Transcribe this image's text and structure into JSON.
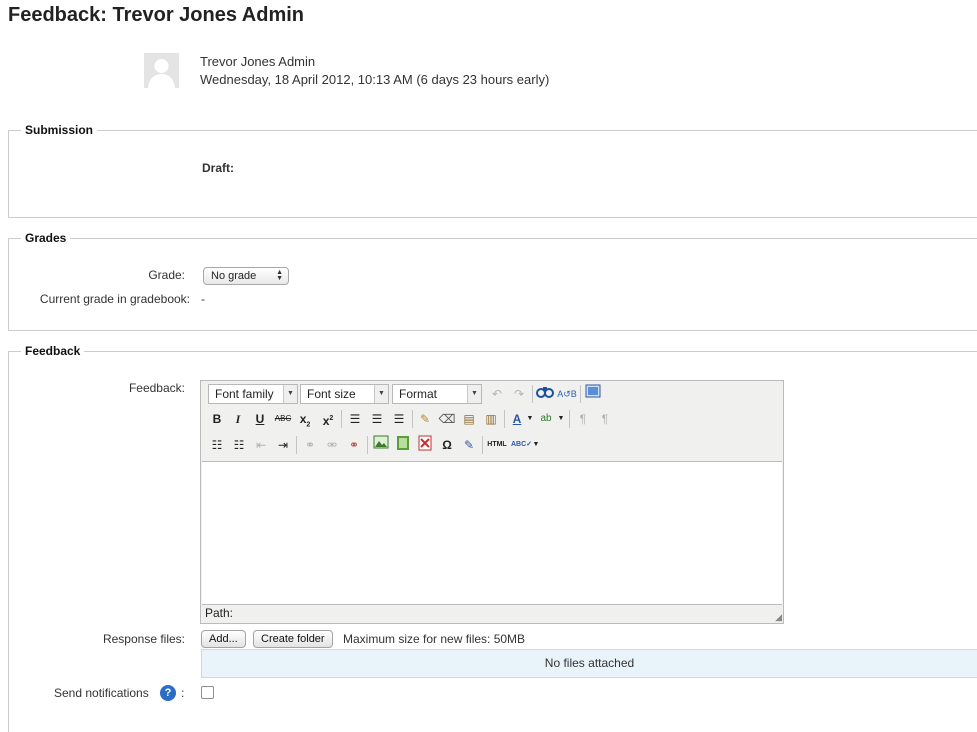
{
  "page": {
    "title": "Feedback: Trevor Jones Admin"
  },
  "user": {
    "name": "Trevor Jones Admin",
    "date": "Wednesday, 18 April 2012, 10:13 AM (6 days 23 hours early)"
  },
  "submission": {
    "legend": "Submission",
    "draft_label": "Draft:"
  },
  "grades": {
    "legend": "Grades",
    "grade_label": "Grade:",
    "grade_selected": "No grade",
    "current_grade_label": "Current grade in gradebook:",
    "current_grade_value": "-"
  },
  "feedback": {
    "legend": "Feedback",
    "feedback_label": "Feedback:",
    "editor": {
      "font_family": "Font family",
      "font_size": "Font size",
      "format": "Format",
      "path_label": "Path:"
    },
    "response_files_label": "Response files:",
    "add_button": "Add...",
    "create_folder_button": "Create folder",
    "max_size_text": "Maximum size for new files: 50MB",
    "no_files_text": "No files attached",
    "send_notifications_label": "Send notifications",
    "colon": ":"
  },
  "colors": {
    "help_icon": "#2b6cc4",
    "files_box_bg": "#e9f3fa"
  }
}
